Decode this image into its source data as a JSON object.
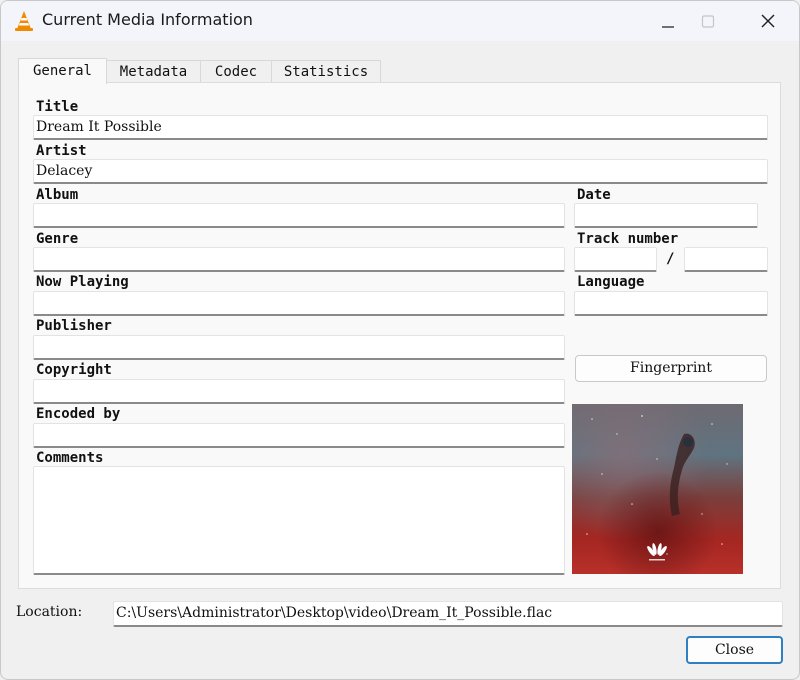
{
  "window": {
    "title": "Current Media Information",
    "app_icon": "vlc-cone-icon",
    "controls": [
      "minimize",
      "maximize",
      "close"
    ]
  },
  "tabs": [
    {
      "label": "General",
      "active": true
    },
    {
      "label": "Metadata",
      "active": false
    },
    {
      "label": "Codec",
      "active": false
    },
    {
      "label": "Statistics",
      "active": false
    }
  ],
  "general": {
    "title": {
      "label": "Title",
      "value": "Dream It Possible"
    },
    "artist": {
      "label": "Artist",
      "value": "Delacey"
    },
    "album": {
      "label": "Album",
      "value": ""
    },
    "date": {
      "label": "Date",
      "value": ""
    },
    "genre": {
      "label": "Genre",
      "value": ""
    },
    "track_number": {
      "label": "Track number",
      "value": "",
      "total": "",
      "separator": "/"
    },
    "now_playing": {
      "label": "Now Playing",
      "value": ""
    },
    "language": {
      "label": "Language",
      "value": ""
    },
    "publisher": {
      "label": "Publisher",
      "value": ""
    },
    "copyright": {
      "label": "Copyright",
      "value": ""
    },
    "encoded_by": {
      "label": "Encoded by",
      "value": ""
    },
    "comments": {
      "label": "Comments",
      "value": ""
    },
    "fingerprint_button": "Fingerprint",
    "album_art": "nebula-cover-art-with-huawei-logo"
  },
  "location": {
    "label": "Location:",
    "value": "C:\\Users\\Administrator\\Desktop\\video\\Dream_It_Possible.flac"
  },
  "footer": {
    "close_button": "Close"
  },
  "colors": {
    "accent": "#2f7fc1",
    "vlc_orange": "#f08a00"
  }
}
